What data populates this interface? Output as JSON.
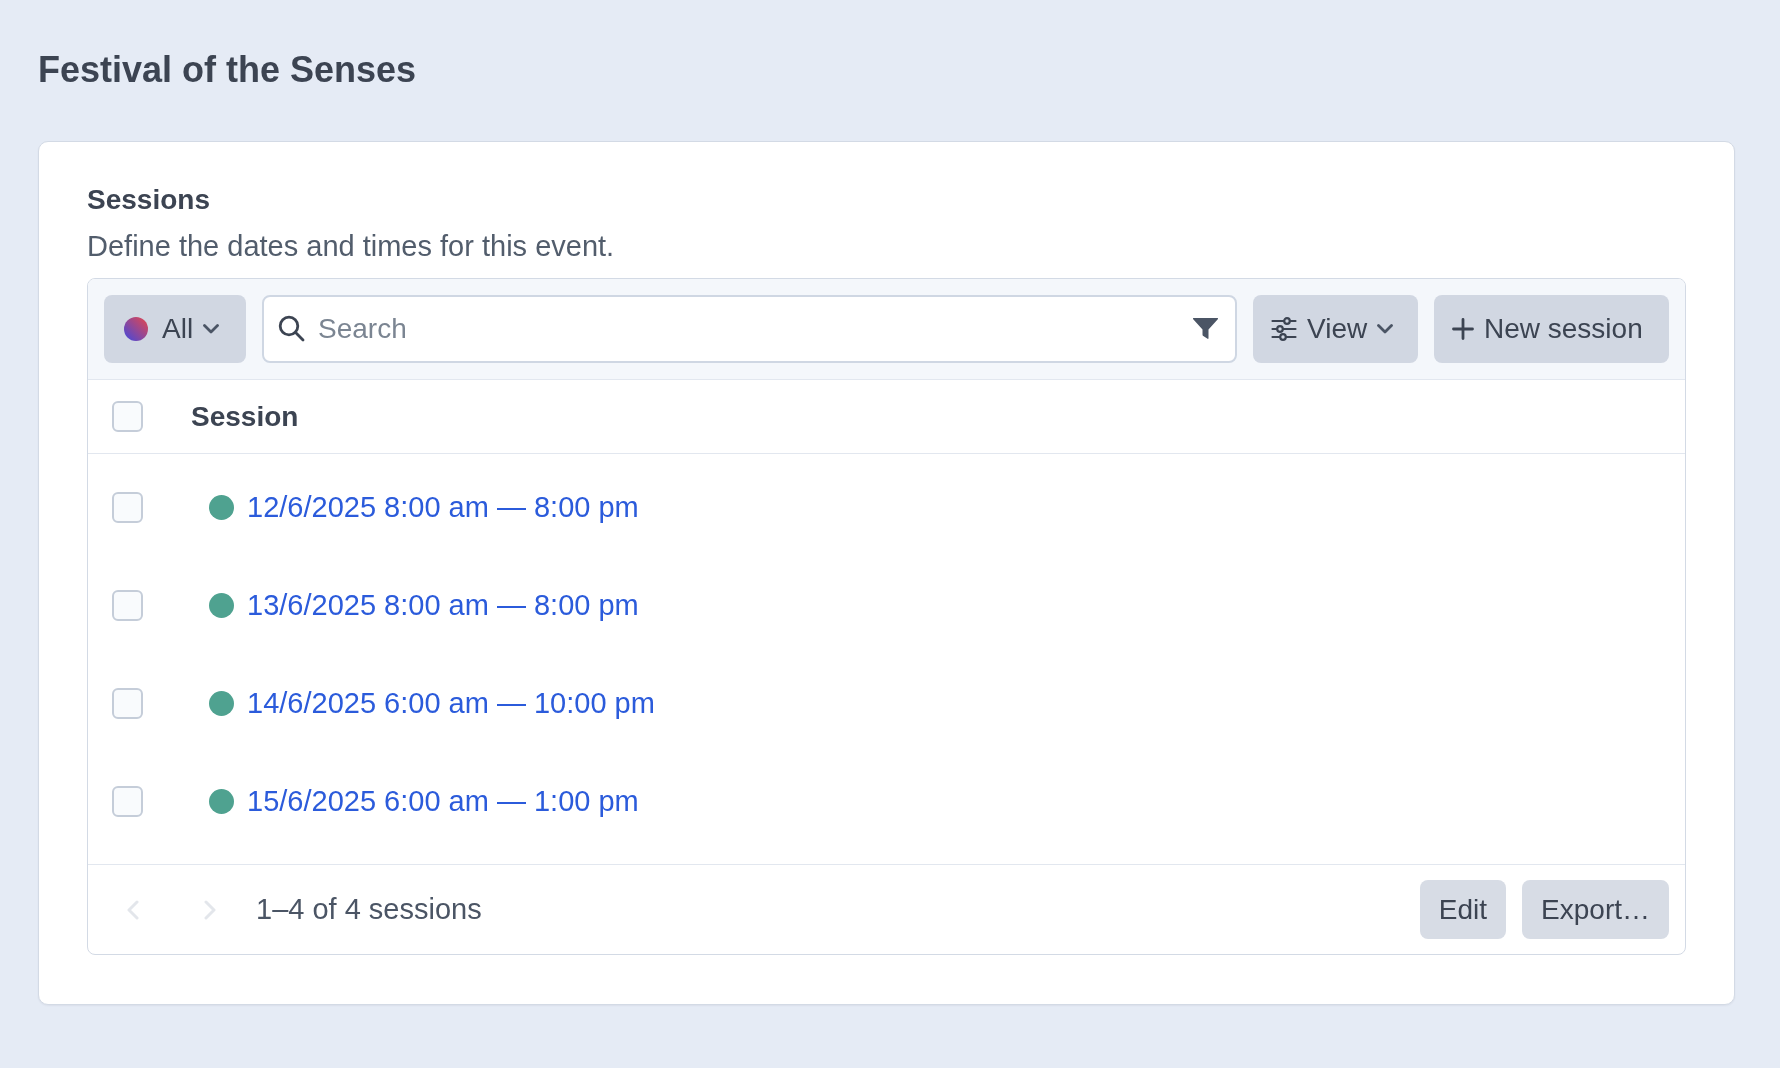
{
  "page": {
    "title": "Festival of the Senses"
  },
  "section": {
    "title": "Sessions",
    "description": "Define the dates and times for this event."
  },
  "toolbar": {
    "filter": {
      "label": "All"
    },
    "search": {
      "placeholder": "Search"
    },
    "view_button": "View",
    "new_button": "New session"
  },
  "table": {
    "header_checkbox": {
      "checked": false
    },
    "columns": [
      "Session"
    ],
    "rows": [
      {
        "checked": false,
        "color": "#4fa290",
        "label": "12/6/2025 8:00 am — 8:00 pm"
      },
      {
        "checked": false,
        "color": "#4fa290",
        "label": "13/6/2025 8:00 am — 8:00 pm"
      },
      {
        "checked": false,
        "color": "#4fa290",
        "label": "14/6/2025 6:00 am — 10:00 pm"
      },
      {
        "checked": false,
        "color": "#4fa290",
        "label": "15/6/2025 6:00 am — 1:00 pm"
      }
    ]
  },
  "footer": {
    "prev": {
      "disabled": true
    },
    "next": {
      "disabled": true
    },
    "summary": "1–4 of 4 sessions",
    "buttons": [
      "Edit",
      "Export…"
    ]
  }
}
